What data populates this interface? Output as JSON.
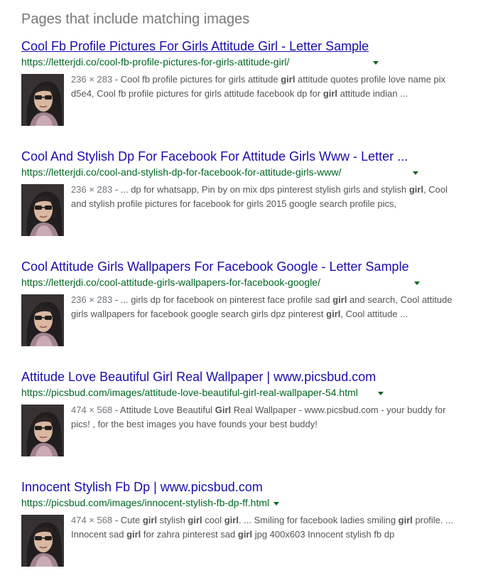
{
  "section": {
    "title": "Pages that include matching images"
  },
  "results": [
    {
      "title": "Cool Fb Profile Pictures For Girls Attitude Girl - Letter Sample",
      "url": "https://letterjdi.co/cool-fb-profile-pictures-for-girls-attitude-girl/",
      "dims": "236 × 283",
      "snippet_line1": [
        {
          "t": " - Cool fb profile pictures for girls attitude ",
          "b": false
        },
        {
          "t": "girl",
          "b": true
        },
        {
          "t": " attitude quotes profile love name pix",
          "b": false
        }
      ],
      "snippet_line2": [
        {
          "t": "d5e4, Cool fb profile pictures for girls attitude facebook dp for ",
          "b": false
        },
        {
          "t": "girl",
          "b": true
        },
        {
          "t": " attitude indian ...",
          "b": false
        }
      ]
    },
    {
      "title": "Cool And Stylish Dp For Facebook For Attitude Girls Www - Letter ...",
      "url": "https://letterjdi.co/cool-and-stylish-dp-for-facebook-for-attitude-girls-www/",
      "dims": "236 × 283",
      "snippet_line1": [
        {
          "t": " - ... dp for whatsapp, Pin by on mix dps pinterest stylish girls and stylish ",
          "b": false
        },
        {
          "t": "girl",
          "b": true
        },
        {
          "t": ", Cool",
          "b": false
        }
      ],
      "snippet_line2": [
        {
          "t": "and stylish profile pictures for facebook for girls 2015 google search profile pics,",
          "b": false
        }
      ]
    },
    {
      "title": "Cool Attitude Girls Wallpapers For Facebook Google - Letter Sample",
      "url": "https://letterjdi.co/cool-attitude-girls-wallpapers-for-facebook-google/",
      "dims": "236 × 283",
      "snippet_line1": [
        {
          "t": " - ... girls dp for facebook on pinterest face profile sad ",
          "b": false
        },
        {
          "t": "girl",
          "b": true
        },
        {
          "t": " and search, Cool attitude",
          "b": false
        }
      ],
      "snippet_line2": [
        {
          "t": "girls wallpapers for facebook google search girls dpz pinterest ",
          "b": false
        },
        {
          "t": "girl",
          "b": true
        },
        {
          "t": ", Cool attitude ...",
          "b": false
        }
      ]
    },
    {
      "title": "Attitude Love Beautiful Girl Real Wallpaper | www.picsbud.com",
      "url": "https://picsbud.com/images/attitude-love-beautiful-girl-real-wallpaper-54.html",
      "dims": "474 × 568",
      "snippet_line1": [
        {
          "t": " - Attitude Love Beautiful ",
          "b": false
        },
        {
          "t": "Girl",
          "b": true
        },
        {
          "t": " Real Wallpaper - www.picsbud.com - your buddy for",
          "b": false
        }
      ],
      "snippet_line2": [
        {
          "t": "pics! , for the best images you have founds your best buddy!",
          "b": false
        }
      ]
    },
    {
      "title": "Innocent Stylish Fb Dp | www.picsbud.com",
      "url": "https://picsbud.com/images/innocent-stylish-fb-dp-ff.html",
      "dims": "474 × 568",
      "snippet_line1": [
        {
          "t": " - Cute ",
          "b": false
        },
        {
          "t": "girl",
          "b": true
        },
        {
          "t": " stylish ",
          "b": false
        },
        {
          "t": "girl",
          "b": true
        },
        {
          "t": " cool ",
          "b": false
        },
        {
          "t": "girl",
          "b": true
        },
        {
          "t": ". ... Smiling for facebook ladies smiling ",
          "b": false
        },
        {
          "t": "girl",
          "b": true
        },
        {
          "t": " profile. ...",
          "b": false
        }
      ],
      "snippet_line2": [
        {
          "t": "Innocent sad ",
          "b": false
        },
        {
          "t": "girl",
          "b": true
        },
        {
          "t": " for zahra pinterest sad ",
          "b": false
        },
        {
          "t": "girl",
          "b": true
        },
        {
          "t": " jpg 400x603 Innocent stylish fb dp",
          "b": false
        }
      ]
    }
  ],
  "icons": {
    "dropdown": "chevron-down-icon",
    "thumbnail": "profile-photo-thumbnail"
  },
  "colors": {
    "title_link": "#1a0dab",
    "url_green": "#006621",
    "snippet_gray": "#545454",
    "section_gray": "#777777"
  }
}
